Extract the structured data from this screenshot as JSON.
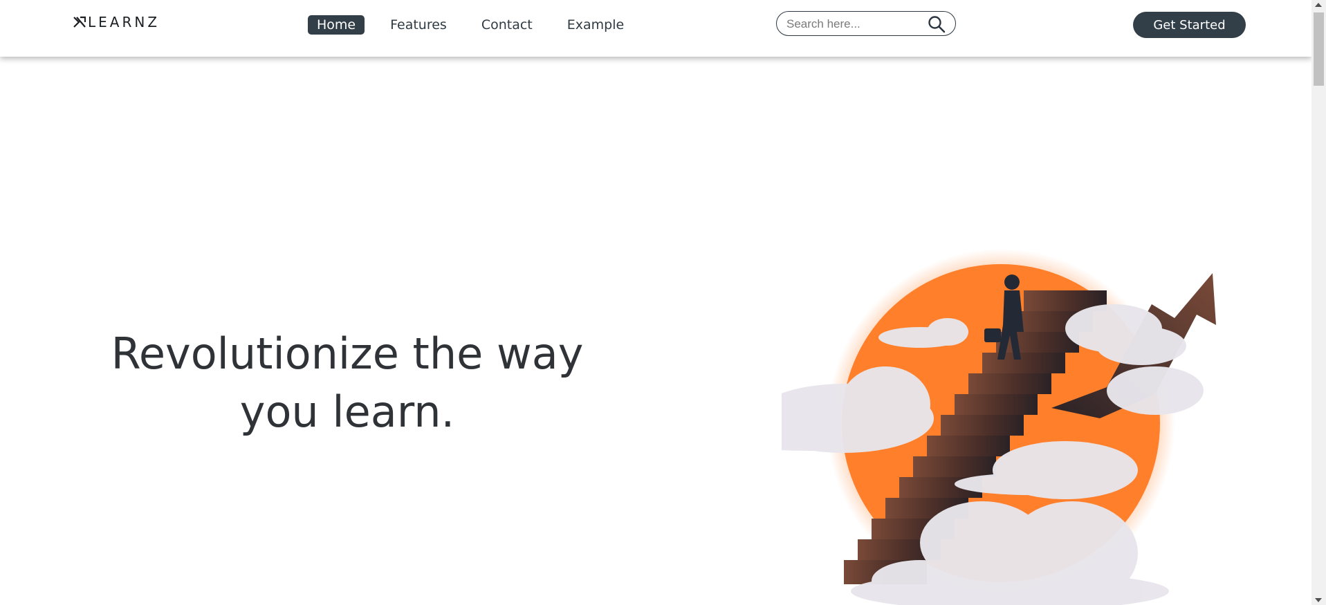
{
  "header": {
    "logo_text": "LEARNZ",
    "nav": [
      {
        "label": "Home",
        "active": true
      },
      {
        "label": "Features",
        "active": false
      },
      {
        "label": "Contact",
        "active": false
      },
      {
        "label": "Example",
        "active": false
      }
    ],
    "search": {
      "placeholder": "Search here...",
      "value": "",
      "icon": "search-icon"
    },
    "cta_label": "Get Started"
  },
  "hero": {
    "title_line1": "Revolutionize the way",
    "title_line2": "you learn.",
    "illustration": "person-climbing-stairs-to-arrow-with-sun-and-clouds"
  },
  "colors": {
    "accent": "#323e48",
    "sun": "#ff7f2a",
    "stairs": "#5b3a2f",
    "cloud": "#e6e4ea"
  }
}
